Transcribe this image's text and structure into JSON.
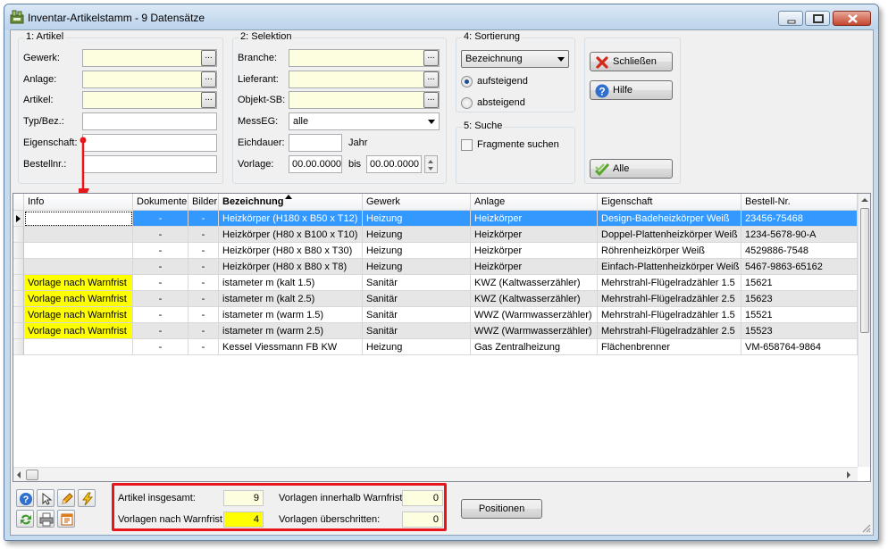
{
  "window": {
    "title": "Inventar-Artikelstamm - 9 Datensätze"
  },
  "artikel_group": {
    "title": "1: Artikel",
    "labels": [
      "Gewerk:",
      "Anlage:",
      "Artikel:",
      "Typ/Bez.:",
      "Eigenschaft:",
      "Bestellnr.:"
    ],
    "values": [
      "",
      "",
      "",
      "",
      "",
      ""
    ]
  },
  "selektion_group": {
    "title": "2: Selektion",
    "branche_label": "Branche:",
    "lieferant_label": "Lieferant:",
    "objekt_label": "Objekt-SB:",
    "messeg_label": "MessEG:",
    "messeg_value": "alle",
    "eichdauer_label": "Eichdauer:",
    "eichdauer_unit": "Jahr",
    "vorlage_label": "Vorlage:",
    "vorlage_from": "00.00.0000",
    "bis_label": "bis",
    "vorlage_to": "00.00.0000"
  },
  "sortierung_group": {
    "title": "4: Sortierung",
    "selected": "Bezeichnung",
    "asc_label": "aufsteigend",
    "desc_label": "absteigend",
    "asc_checked": true
  },
  "suche_group": {
    "title": "5: Suche",
    "fragmente_label": "Fragmente suchen",
    "fragmente_checked": false
  },
  "buttons": {
    "close": "Schließen",
    "help": "Hilfe",
    "all": "Alle",
    "positionen": "Positionen"
  },
  "grid": {
    "columns": [
      "Info",
      "Dokumente",
      "Bilder",
      "Bezeichnung",
      "Gewerk",
      "Anlage",
      "Eigenschaft",
      "Bestell-Nr."
    ],
    "sorted_column": "Bezeichnung",
    "rows": [
      {
        "info": "",
        "dokumente": "-",
        "bilder": "-",
        "bezeichnung": "Heizkörper (H180 x B50 x T12)",
        "gewerk": "Heizung",
        "anlage": "Heizkörper",
        "eigenschaft": "Design-Badeheizkörper Weiß",
        "bestellnr": "23456-75468",
        "selected": true,
        "warn": false
      },
      {
        "info": "",
        "dokumente": "-",
        "bilder": "-",
        "bezeichnung": "Heizkörper (H80 x B100 x T10)",
        "gewerk": "Heizung",
        "anlage": "Heizkörper",
        "eigenschaft": "Doppel-Plattenheizkörper Weiß",
        "bestellnr": "1234-5678-90-A",
        "selected": false,
        "warn": false
      },
      {
        "info": "",
        "dokumente": "-",
        "bilder": "-",
        "bezeichnung": "Heizkörper (H80 x B80 x T30)",
        "gewerk": "Heizung",
        "anlage": "Heizkörper",
        "eigenschaft": "Röhrenheizkörper Weiß",
        "bestellnr": "4529886-7548",
        "selected": false,
        "warn": false
      },
      {
        "info": "",
        "dokumente": "-",
        "bilder": "-",
        "bezeichnung": "Heizkörper (H80 x B80 x T8)",
        "gewerk": "Heizung",
        "anlage": "Heizkörper",
        "eigenschaft": "Einfach-Plattenheizkörper Weiß",
        "bestellnr": "5467-9863-65162",
        "selected": false,
        "warn": false
      },
      {
        "info": "Vorlage nach Warnfrist",
        "dokumente": "-",
        "bilder": "-",
        "bezeichnung": "istameter m (kalt 1.5)",
        "gewerk": "Sanitär",
        "anlage": "KWZ (Kaltwasserzähler)",
        "eigenschaft": "Mehrstrahl-Flügelradzähler 1.5",
        "bestellnr": "15621",
        "selected": false,
        "warn": true
      },
      {
        "info": "Vorlage nach Warnfrist",
        "dokumente": "-",
        "bilder": "-",
        "bezeichnung": "istameter m (kalt 2.5)",
        "gewerk": "Sanitär",
        "anlage": "KWZ (Kaltwasserzähler)",
        "eigenschaft": "Mehrstrahl-Flügelradzähler 2.5",
        "bestellnr": "15623",
        "selected": false,
        "warn": true
      },
      {
        "info": "Vorlage nach Warnfrist",
        "dokumente": "-",
        "bilder": "-",
        "bezeichnung": "istameter m (warm 1.5)",
        "gewerk": "Sanitär",
        "anlage": "WWZ (Warmwasserzähler)",
        "eigenschaft": "Mehrstrahl-Flügelradzähler 1.5",
        "bestellnr": "15521",
        "selected": false,
        "warn": true
      },
      {
        "info": "Vorlage nach Warnfrist",
        "dokumente": "-",
        "bilder": "-",
        "bezeichnung": "istameter m (warm 2.5)",
        "gewerk": "Sanitär",
        "anlage": "WWZ (Warmwasserzähler)",
        "eigenschaft": "Mehrstrahl-Flügelradzähler 2.5",
        "bestellnr": "15523",
        "selected": false,
        "warn": true
      },
      {
        "info": "",
        "dokumente": "-",
        "bilder": "-",
        "bezeichnung": "Kessel Viessmann FB KW",
        "gewerk": "Heizung",
        "anlage": "Gas Zentralheizung",
        "eigenschaft": "Flächenbrenner",
        "bestellnr": "VM-658764-9864",
        "selected": false,
        "warn": false
      }
    ]
  },
  "summary": {
    "artikel_label": "Artikel insgesamt:",
    "artikel_value": "9",
    "vorlagen_nach_label": "Vorlagen nach Warnfrist:",
    "vorlagen_nach_value": "4",
    "innerhalb_label": "Vorlagen innerhalb Warnfrist:",
    "innerhalb_value": "0",
    "ueberschritten_label": "Vorlagen überschritten:",
    "ueberschritten_value": "0"
  },
  "colors": {
    "selection": "#3399ff",
    "warning": "#ffff00",
    "annotation": "#e8161b",
    "input_bg": "#fdfde0"
  },
  "icons": [
    "app-icon",
    "minimize-icon",
    "maximize-icon",
    "close-icon",
    "close-x-icon",
    "help-icon",
    "check-icon",
    "question-tool-icon",
    "pointer-tool-icon",
    "pencil-tool-icon",
    "lightning-tool-icon",
    "refresh-tool-icon",
    "print-tool-icon",
    "export-tool-icon"
  ]
}
